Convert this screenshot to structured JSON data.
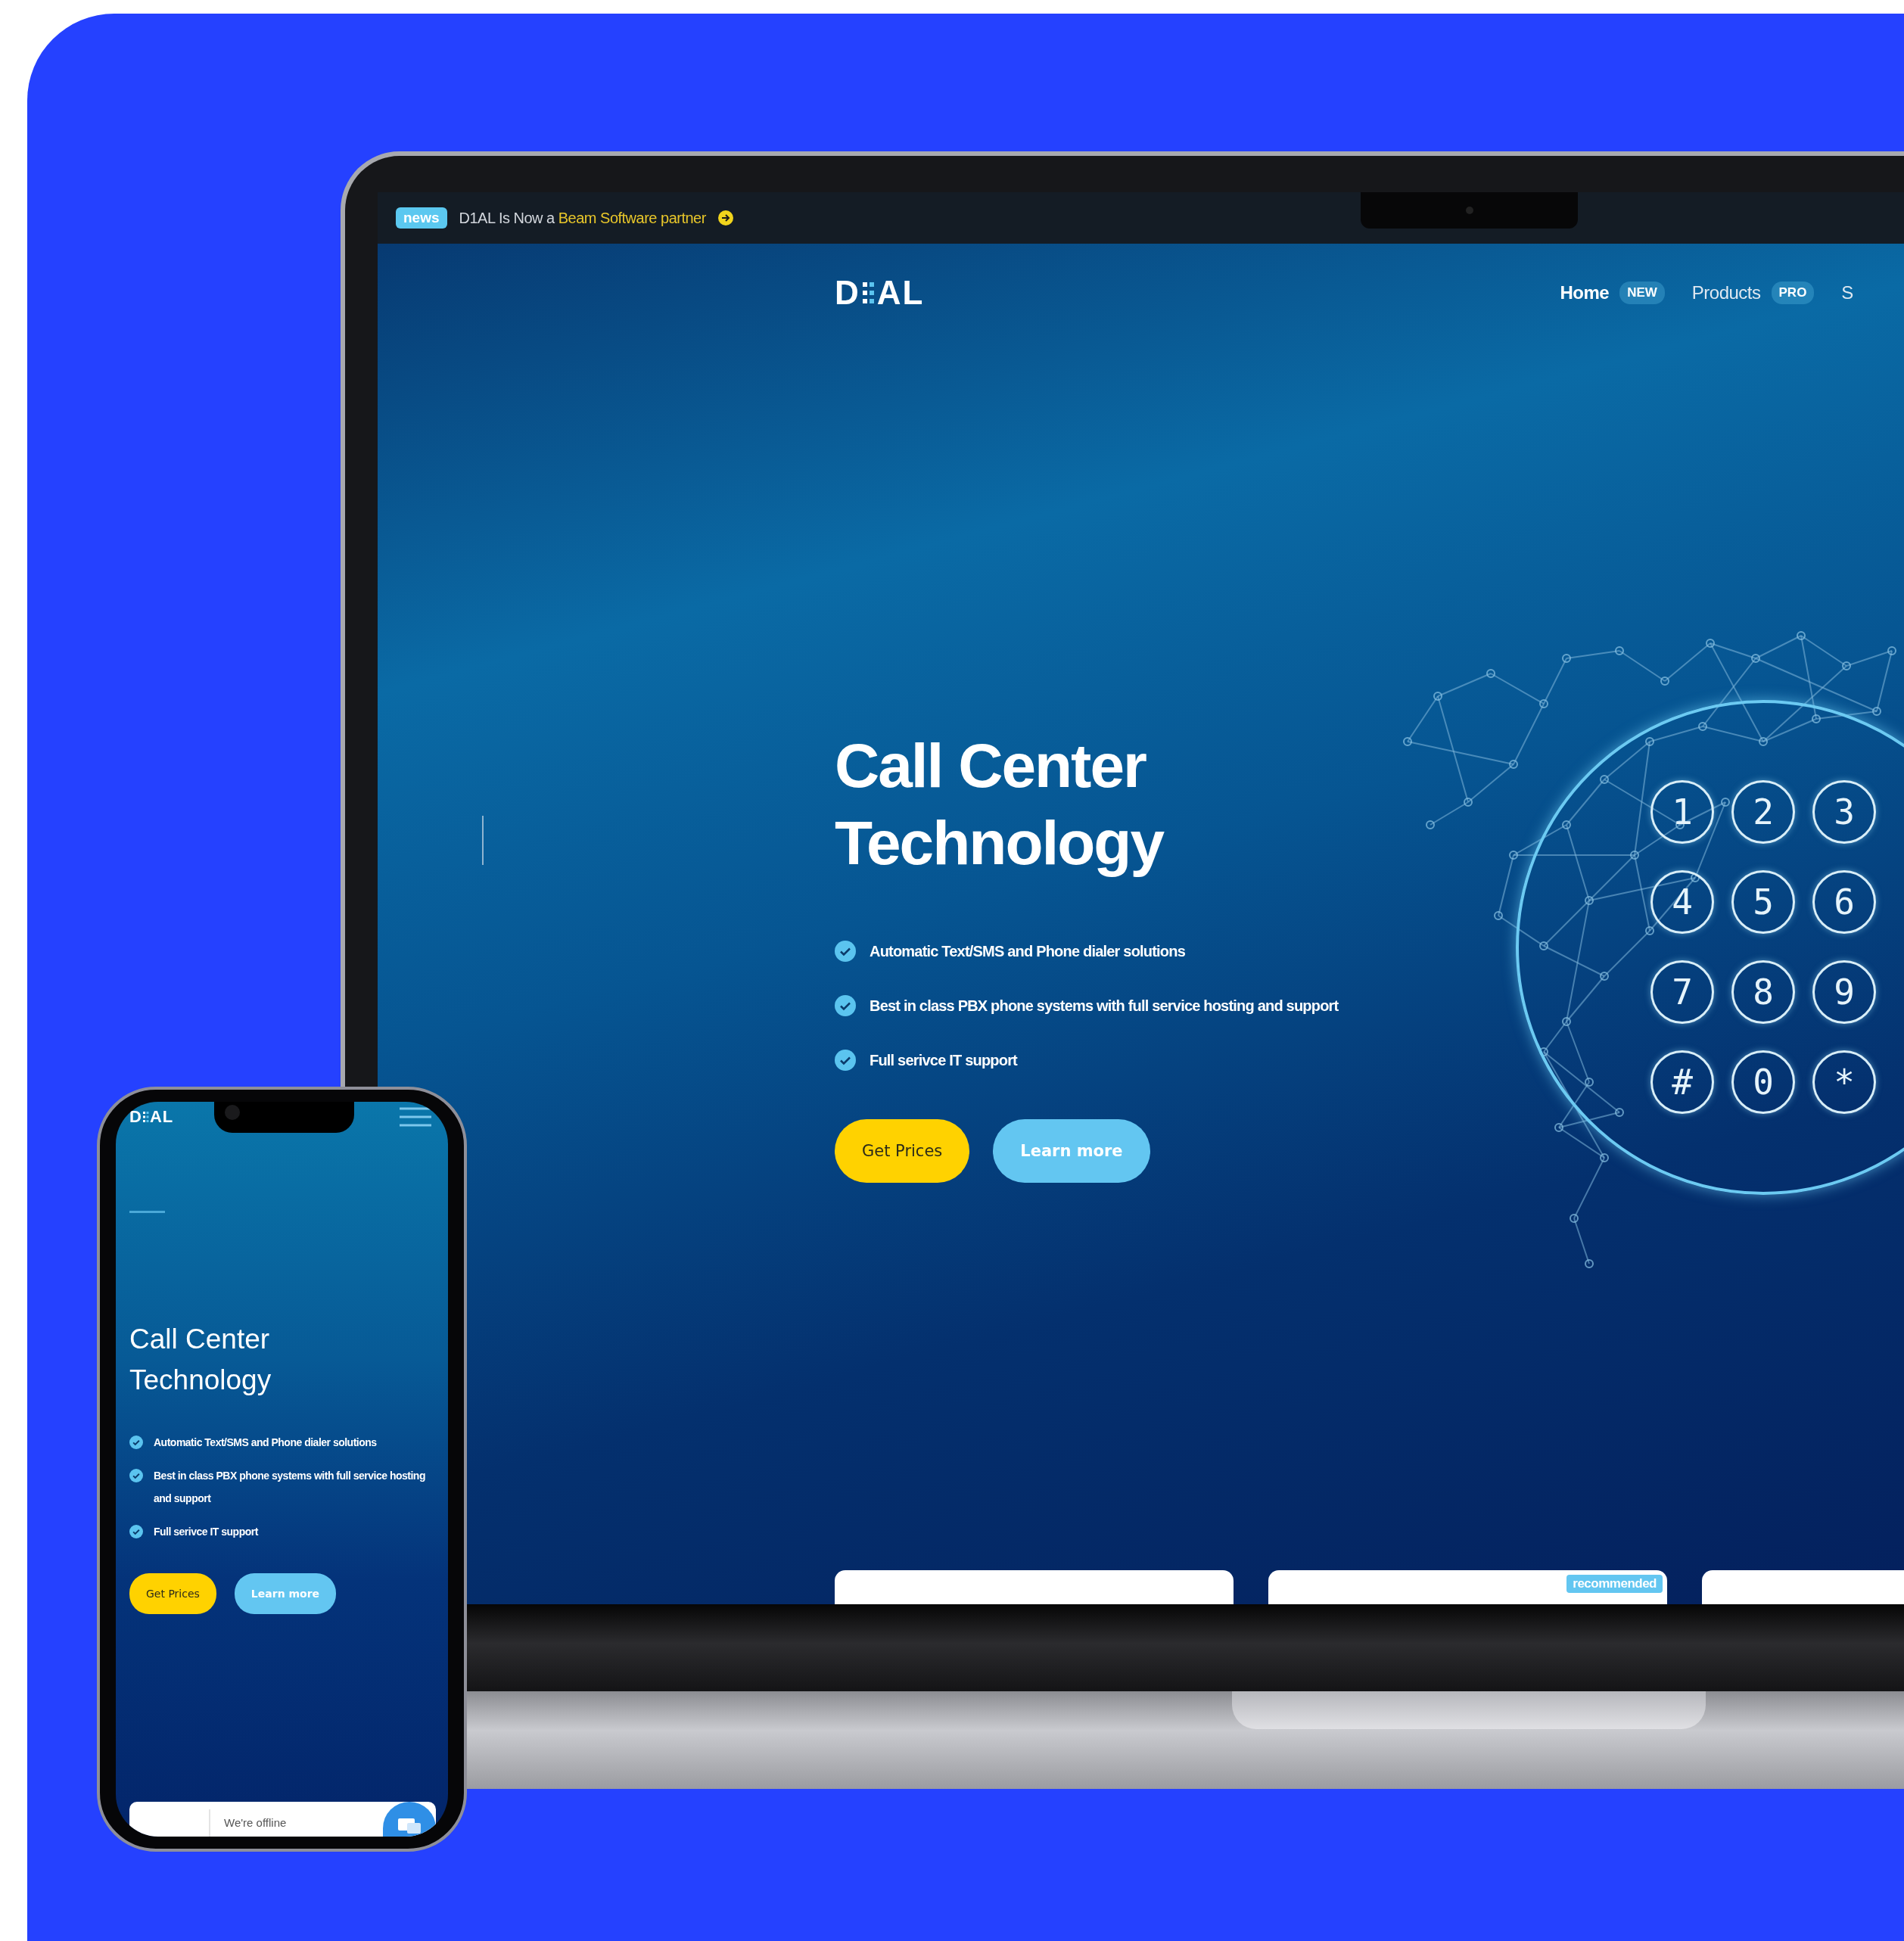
{
  "laptop": {
    "announcement": {
      "badge": "news",
      "text": "D1AL Is Now a",
      "link": "Beam Software partner"
    },
    "logo": {
      "left": "D",
      "right": "AL"
    },
    "nav": [
      {
        "label": "Home",
        "badge": "NEW",
        "selected": true
      },
      {
        "label": "Products",
        "badge": "PRO",
        "selected": false
      },
      {
        "label": "S",
        "selected": false
      }
    ],
    "hero": {
      "title_lines": [
        "Call Center",
        "Technology"
      ],
      "features": [
        "Automatic Text/SMS and Phone dialer solutions",
        "Best in class PBX phone systems with full service hosting and support",
        "Full serivce IT support"
      ],
      "buttons": [
        {
          "label": "Get Prices",
          "kind": "primary"
        },
        {
          "label": "Learn more",
          "kind": "secondary"
        }
      ]
    },
    "dialpad": {
      "keys": [
        "1",
        "2",
        "3",
        "4",
        "5",
        "6",
        "7",
        "8",
        "9",
        "#",
        "0",
        "*"
      ]
    },
    "cards": [
      {
        "kind": "plain"
      },
      {
        "kind": "badged",
        "badge": "recommended"
      },
      {
        "kind": "plain"
      }
    ]
  },
  "phone": {
    "logo": {
      "left": "D",
      "right": "AL"
    },
    "hero": {
      "title_lines": [
        "Call Center",
        "Technology"
      ],
      "features": [
        "Automatic Text/SMS and Phone dialer solutions",
        "Best in class PBX phone systems with full service hosting and support",
        "Full serivce IT support"
      ],
      "buttons": [
        {
          "label": "Get Prices",
          "kind": "primary"
        },
        {
          "label": "Learn more",
          "kind": "secondary"
        }
      ]
    },
    "chat": {
      "status": "We're offline"
    }
  }
}
